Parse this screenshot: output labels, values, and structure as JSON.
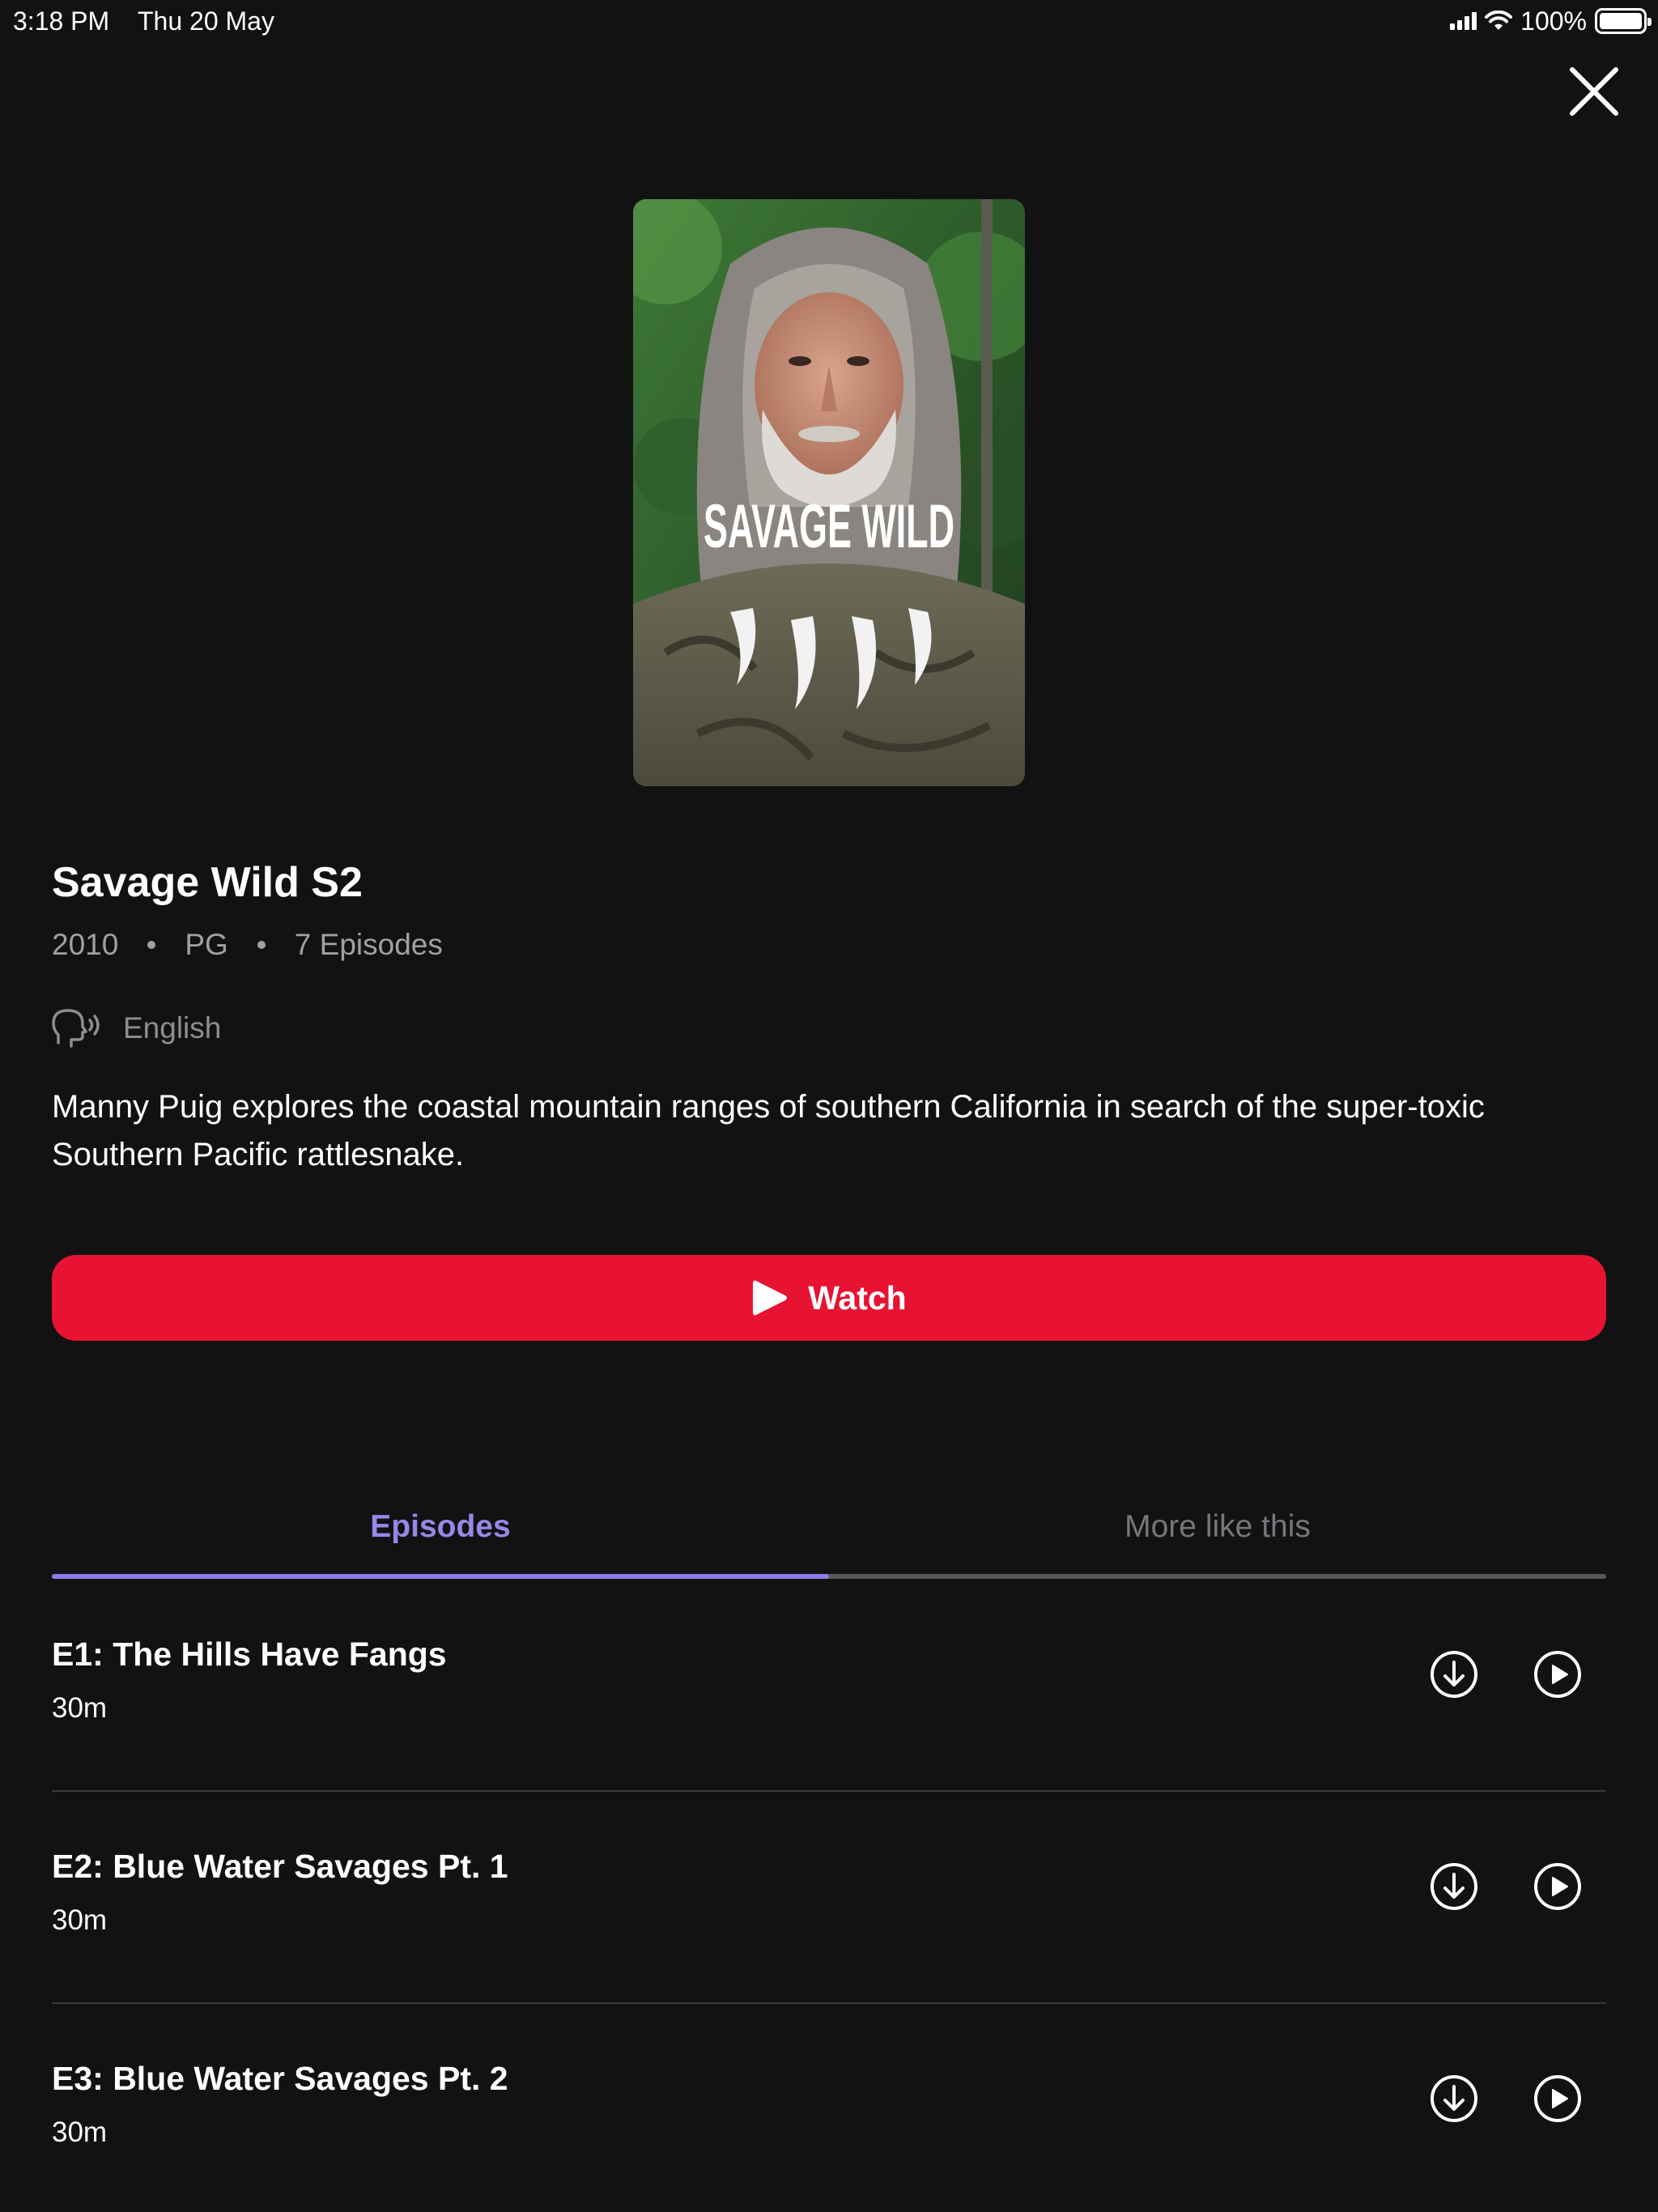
{
  "status_bar": {
    "time": "3:18 PM",
    "date": "Thu 20 May",
    "battery": "100%",
    "icons": [
      "signal-icon",
      "wifi-icon",
      "battery-icon"
    ]
  },
  "close_icon": "close-icon",
  "poster": {
    "logo_text": "SAVAGE WILD"
  },
  "show": {
    "title": "Savage Wild S2",
    "year": "2010",
    "rating": "PG",
    "episodes_count": "7 Episodes",
    "audio_language": "English",
    "description": "Manny Puig explores the coastal mountain ranges of southern California in search of the super-toxic Southern Pacific rattlesnake."
  },
  "watch_button": {
    "label": "Watch"
  },
  "tabs": [
    {
      "label": "Episodes",
      "active": true
    },
    {
      "label": "More like this",
      "active": false
    }
  ],
  "episodes": [
    {
      "title": "E1: The Hills Have Fangs",
      "duration": "30m"
    },
    {
      "title": "E2: Blue Water Savages Pt. 1",
      "duration": "30m"
    },
    {
      "title": "E3: Blue Water Savages Pt. 2",
      "duration": "30m"
    }
  ],
  "colors": {
    "background": "#121213",
    "watch_button": "#e81233",
    "tab_active": "#9a86e8",
    "tab_inactive": "#76767c"
  }
}
